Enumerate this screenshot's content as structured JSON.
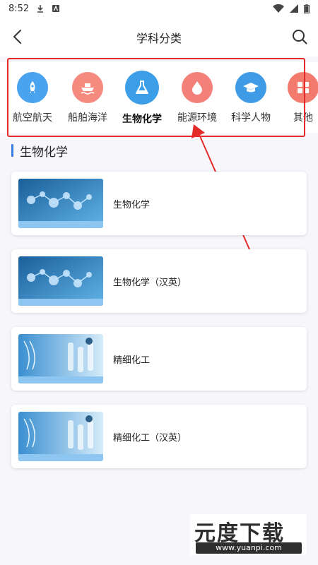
{
  "status_bar": {
    "time": "8:52"
  },
  "header": {
    "title": "学科分类"
  },
  "categories": [
    {
      "label": "航空航天",
      "icon": "rocket-icon",
      "color": "#4aa3ee",
      "active": false
    },
    {
      "label": "船舶海洋",
      "icon": "ship-icon",
      "color": "#f58b7e",
      "active": false
    },
    {
      "label": "生物化学",
      "icon": "flask-icon",
      "color": "#3d9ee8",
      "active": true
    },
    {
      "label": "能源环境",
      "icon": "droplet-icon",
      "color": "#f4807a",
      "active": false
    },
    {
      "label": "科学人物",
      "icon": "graduation-cap-icon",
      "color": "#3f9be6",
      "active": false
    },
    {
      "label": "其他",
      "icon": "grid-icon",
      "color": "#f37b6e",
      "active": false
    }
  ],
  "section": {
    "title": "生物化学"
  },
  "cards": [
    {
      "title": "生物化学",
      "theme": "molecule"
    },
    {
      "title": "生物化学（汉英）",
      "theme": "molecule"
    },
    {
      "title": "精细化工",
      "theme": "lab"
    },
    {
      "title": "精细化工（汉英）",
      "theme": "lab"
    }
  ],
  "watermark": {
    "brand": "元度下载",
    "url": "www.yuanpi.com"
  },
  "colors": {
    "accent": "#3a7be0",
    "highlight": "#e52a2a"
  }
}
